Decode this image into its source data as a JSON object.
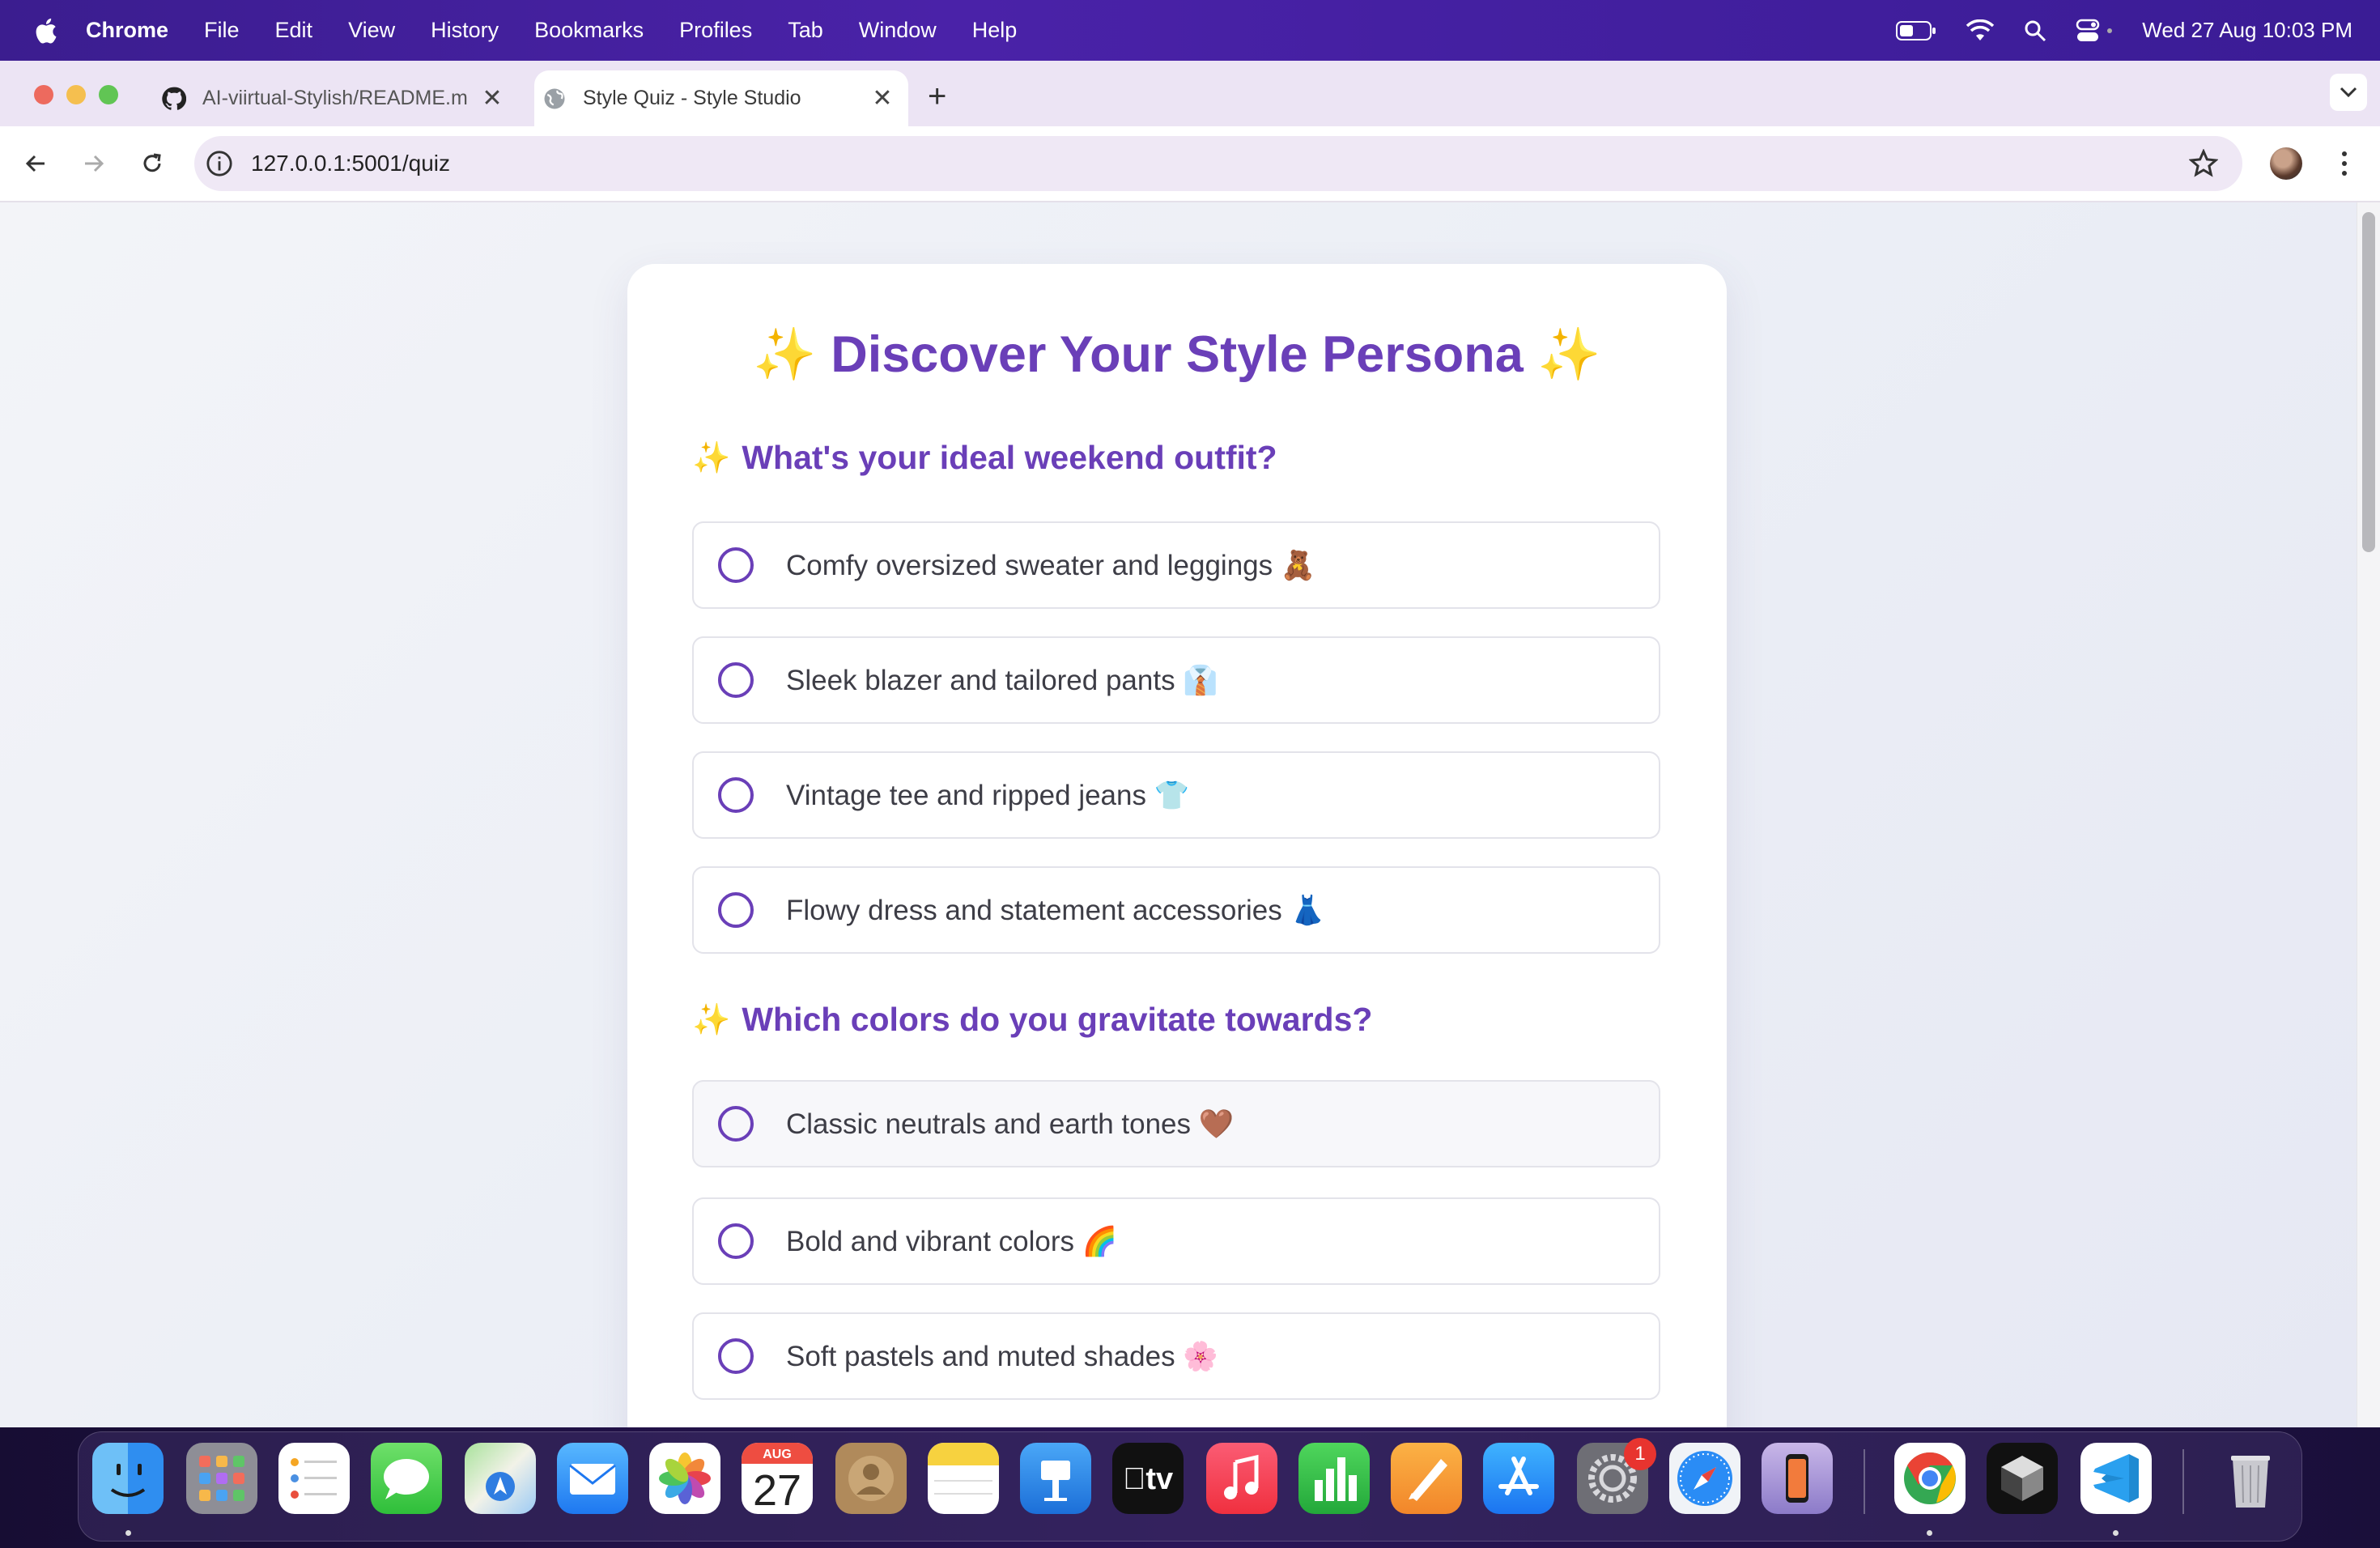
{
  "menubar": {
    "app_name": "Chrome",
    "menus": [
      "File",
      "Edit",
      "View",
      "History",
      "Bookmarks",
      "Profiles",
      "Tab",
      "Window",
      "Help"
    ],
    "clock": "Wed 27 Aug  10:03 PM"
  },
  "browser": {
    "tabs": [
      {
        "title": "AI-viirtual-Stylish/README.m",
        "favicon": "github-icon",
        "active": false
      },
      {
        "title": "Style Quiz - Style Studio",
        "favicon": "globe-icon",
        "active": true
      }
    ],
    "close_glyph": "✕",
    "new_tab_glyph": "+",
    "url": "127.0.0.1:5001/quiz"
  },
  "page": {
    "title_spark": "✨",
    "title": "Discover Your Style Persona",
    "questions": [
      {
        "spark": "✨",
        "text": "What's your ideal weekend outfit?",
        "options": [
          "Comfy oversized sweater and leggings 🧸",
          "Sleek blazer and tailored pants 👔",
          "Vintage tee and ripped jeans 👕",
          "Flowy dress and statement accessories 👗"
        ]
      },
      {
        "spark": "✨",
        "text": "Which colors do you gravitate towards?",
        "options": [
          "Classic neutrals and earth tones 🤎",
          "Bold and vibrant colors 🌈",
          "Soft pastels and muted shades 🌸"
        ]
      }
    ]
  },
  "dock": {
    "calendar_month": "AUG",
    "calendar_day": "27",
    "tv_label": "tv",
    "settings_badge": "1",
    "apps": [
      "finder",
      "launchpad",
      "reminders",
      "messages",
      "maps",
      "mail",
      "photos",
      "calendar",
      "contacts",
      "notes",
      "keynote",
      "apple-tv",
      "music",
      "numbers",
      "pages",
      "app-store",
      "system-settings",
      "safari",
      "iphone-mirroring",
      "chrome",
      "cursor",
      "vscode",
      "trash"
    ]
  }
}
